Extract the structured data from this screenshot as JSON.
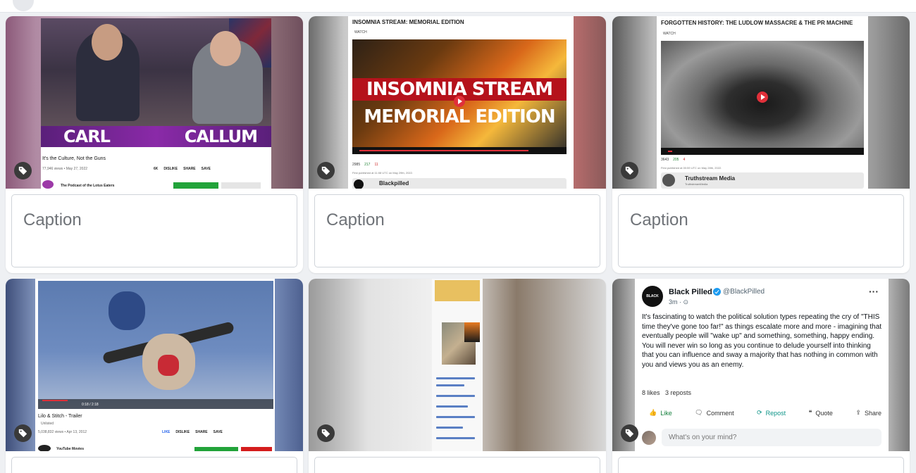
{
  "caption_placeholder": "Caption",
  "cards": [
    {
      "title": "It's the Culture, Not the Guns",
      "meta": "77,946 views • May 27, 2022",
      "actions": [
        "6K",
        "DISLIKE",
        "SHARE",
        "SAVE"
      ],
      "name_left": "CARL",
      "name_right": "CALLUM",
      "channel": "The Podcast of the Lotus Eaters"
    },
    {
      "heading": "INSOMNIA STREAM: MEMORIAL EDITION",
      "watch": "WATCH",
      "overlay_line1": "INSOMNIA STREAM",
      "overlay_line2": "MEMORIAL EDITION",
      "views": "2985",
      "likes": "217",
      "dislikes": "11",
      "published": "First published at 11:08 UTC on May 29th, 2022.",
      "channel": "Blackpilled"
    },
    {
      "heading": "FORGOTTEN HISTORY: THE LUDLOW MASSACRE & THE PR MACHINE",
      "watch": "WATCH",
      "views": "3643",
      "likes": "205",
      "dislikes": "4",
      "published": "First published at 00:59 UTC on May 28th, 2022.",
      "channel": "Truthstream Media",
      "channel_sub": "TruthstreamMedia"
    },
    {
      "title": "Lilo & Stitch - Trailer",
      "status": "Unlisted",
      "meta": "5,038,832 views • Apr 13, 2012",
      "actions": [
        "LIKE",
        "DISLIKE",
        "SHARE",
        "SAVE"
      ],
      "time": "0:18 / 2:18",
      "channel": "YouTube Movies"
    },
    {},
    {
      "name": "Black Pilled",
      "handle": "@BlackPilled",
      "time": "3m",
      "body_p1": "It's fascinating to watch the political solution types repeating the cry of \"THIS time they've gone too far!\" as things escalate more and more - imagining that eventually people will \"wake up\" and something, something, happy ending.",
      "body_p2": "You will never win so long as you continue to delude yourself into thinking that you can influence and sway a majority that has nothing in common with you and views you as an enemy.",
      "likes_label": "8 likes",
      "reposts_label": "3 reposts",
      "actions": [
        "Like",
        "Comment",
        "Repost",
        "Quote",
        "Share"
      ],
      "compose_placeholder": "What's on your mind?"
    }
  ]
}
